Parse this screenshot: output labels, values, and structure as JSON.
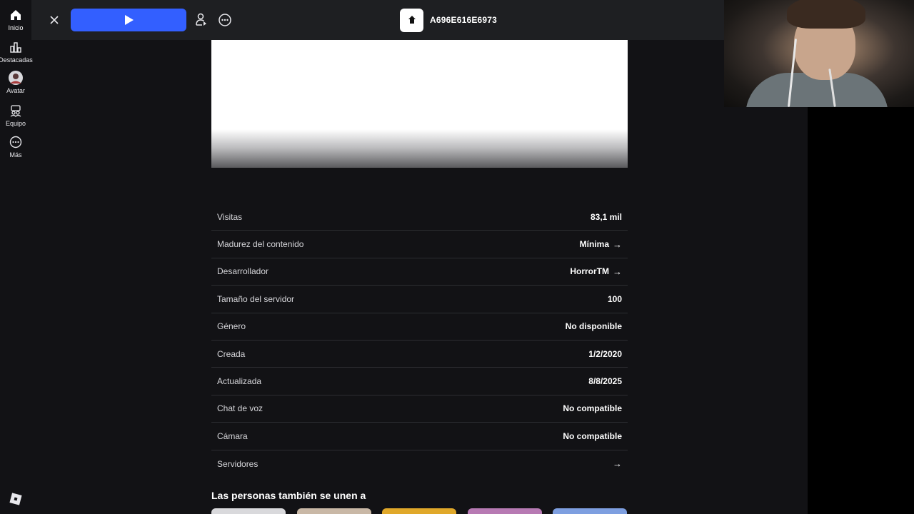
{
  "nav": {
    "items": [
      {
        "label": "Inicio",
        "icon": "home-icon"
      },
      {
        "label": "Destacadas",
        "icon": "charts-icon"
      },
      {
        "label": "Avatar",
        "icon": "avatar-icon"
      },
      {
        "label": "Equipo",
        "icon": "party-icon"
      },
      {
        "label": "Más",
        "icon": "more-icon"
      }
    ],
    "logo_icon": "roblox-logo-icon"
  },
  "topbar": {
    "close_icon": "close-icon",
    "play_icon": "play-icon",
    "friend_icon": "person-invite-icon",
    "more_icon": "more-options-icon",
    "game_name": "A696E616E6973"
  },
  "details": {
    "rows": [
      {
        "key": "Visitas",
        "value": "83,1 mil",
        "link": false
      },
      {
        "key": "Madurez del contenido",
        "value": "Mínima",
        "link": true
      },
      {
        "key": "Desarrollador",
        "value": "HorrorTM",
        "link": true
      },
      {
        "key": "Tamaño del servidor",
        "value": "100",
        "link": false
      },
      {
        "key": "Género",
        "value": "No disponible",
        "link": false
      },
      {
        "key": "Creada",
        "value": "1/2/2020",
        "link": false
      },
      {
        "key": "Actualizada",
        "value": "8/8/2025",
        "link": false
      },
      {
        "key": "Chat de voz",
        "value": "No compatible",
        "link": false
      },
      {
        "key": "Cámara",
        "value": "No compatible",
        "link": false
      },
      {
        "key": "Servidores",
        "value": "",
        "link": true
      }
    ],
    "arrow": "→"
  },
  "recommended": {
    "title": "Las personas también se unen a",
    "card_colors": [
      "#d9d9dc",
      "#c9b8a6",
      "#e0a82a",
      "#b77ab3",
      "#7e9fe0"
    ]
  },
  "colors": {
    "accent": "#335fff",
    "background": "#121215",
    "topbar": "#1e1f22"
  }
}
